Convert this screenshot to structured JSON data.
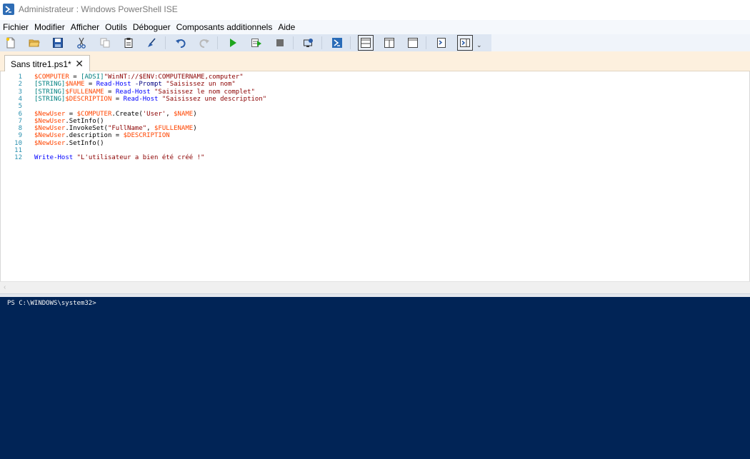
{
  "window": {
    "title": "Administrateur : Windows PowerShell ISE"
  },
  "menu": [
    "Fichier",
    "Modifier",
    "Afficher",
    "Outils",
    "Déboguer",
    "Composants additionnels",
    "Aide"
  ],
  "toolbar": {
    "buttons": [
      "new-script",
      "open",
      "save",
      "cut",
      "copy",
      "paste",
      "clear-console",
      "undo",
      "redo",
      "run-script",
      "run-selection",
      "stop",
      "new-remote-tab",
      "start-powershell",
      "show-script-top",
      "show-script-right",
      "show-script-maximized",
      "show-command-window",
      "show-command-addon"
    ],
    "more": "⌄"
  },
  "tabs": [
    {
      "label": "Sans titre1.ps1*",
      "close": "✕"
    }
  ],
  "editor": {
    "lines": [
      {
        "n": "1",
        "parts": [
          [
            "var",
            "$COMPUTER"
          ],
          [
            "plain",
            " = "
          ],
          [
            "type",
            "[ADSI]"
          ],
          [
            "str",
            "\"WinNT://$ENV:COMPUTERNAME,computer\""
          ]
        ]
      },
      {
        "n": "2",
        "parts": [
          [
            "type",
            "[STRING]"
          ],
          [
            "var",
            "$NAME"
          ],
          [
            "plain",
            " = "
          ],
          [
            "cmd",
            "Read-Host"
          ],
          [
            "plain",
            " "
          ],
          [
            "param",
            "-Prompt"
          ],
          [
            "plain",
            " "
          ],
          [
            "str",
            "\"Saisissez un nom\""
          ]
        ]
      },
      {
        "n": "3",
        "parts": [
          [
            "type",
            "[STRING]"
          ],
          [
            "var",
            "$FULLENAME"
          ],
          [
            "plain",
            " = "
          ],
          [
            "cmd",
            "Read-Host"
          ],
          [
            "plain",
            " "
          ],
          [
            "str",
            "\"Saisissez le nom complet\""
          ]
        ]
      },
      {
        "n": "4",
        "parts": [
          [
            "type",
            "[STRING]"
          ],
          [
            "var",
            "$DESCRIPTION"
          ],
          [
            "plain",
            " = "
          ],
          [
            "cmd",
            "Read-Host"
          ],
          [
            "plain",
            " "
          ],
          [
            "str",
            "\"Saisissez une description\""
          ]
        ]
      },
      {
        "n": "5",
        "parts": []
      },
      {
        "n": "6",
        "parts": [
          [
            "var",
            "$NewUser"
          ],
          [
            "plain",
            " = "
          ],
          [
            "var",
            "$COMPUTER"
          ],
          [
            "plain",
            ".Create("
          ],
          [
            "str",
            "'User'"
          ],
          [
            "plain",
            ", "
          ],
          [
            "var",
            "$NAME"
          ],
          [
            "plain",
            ")"
          ]
        ]
      },
      {
        "n": "7",
        "parts": [
          [
            "var",
            "$NewUser"
          ],
          [
            "plain",
            ".SetInfo()"
          ]
        ]
      },
      {
        "n": "8",
        "parts": [
          [
            "var",
            "$NewUser"
          ],
          [
            "plain",
            ".InvokeSet("
          ],
          [
            "str",
            "\"FullName\""
          ],
          [
            "plain",
            ", "
          ],
          [
            "var",
            "$FULLENAME"
          ],
          [
            "plain",
            ")"
          ]
        ]
      },
      {
        "n": "9",
        "parts": [
          [
            "var",
            "$NewUser"
          ],
          [
            "plain",
            ".description = "
          ],
          [
            "var",
            "$DESCRIPTION"
          ]
        ]
      },
      {
        "n": "10",
        "parts": [
          [
            "var",
            "$NewUser"
          ],
          [
            "plain",
            ".SetInfo()"
          ]
        ]
      },
      {
        "n": "11",
        "parts": []
      },
      {
        "n": "12",
        "parts": [
          [
            "cmd",
            "Write-Host"
          ],
          [
            "plain",
            " "
          ],
          [
            "str",
            "\"L'utilisateur a bien été créé !\""
          ]
        ]
      }
    ]
  },
  "scroll": {
    "left_arrow": "‹"
  },
  "console": {
    "prompt": "PS C:\\WINDOWS\\system32>"
  },
  "colors": {
    "console_bg": "#012456",
    "tabstrip_bg": "#fdf0de",
    "variable": "#ff4500",
    "type": "#008080",
    "string": "#8b0000",
    "command": "#0000ff"
  }
}
